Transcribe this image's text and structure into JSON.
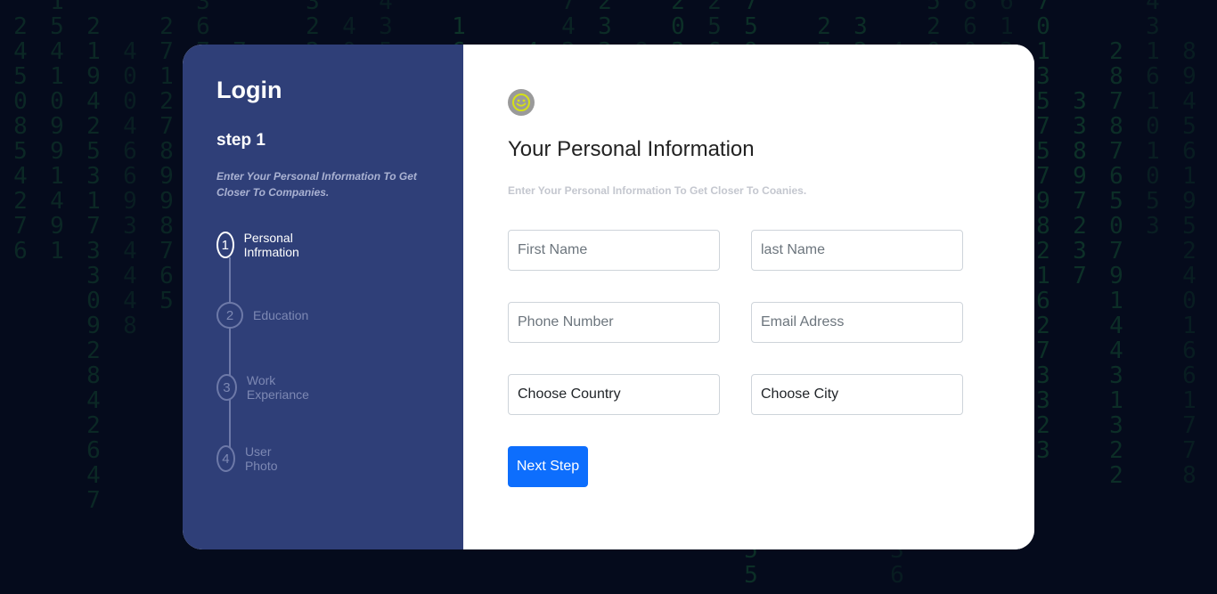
{
  "sidebar": {
    "title": "Login",
    "step": "step 1",
    "description": "Enter Your Personal Information To Get Closer To Companies.",
    "steps": [
      {
        "number": "1",
        "label": "Personal Infrmation",
        "active": true
      },
      {
        "number": "2",
        "label": "Education",
        "active": false
      },
      {
        "number": "3",
        "label": "Work Experiance",
        "active": false
      },
      {
        "number": "4",
        "label": "User Photo",
        "active": false
      }
    ]
  },
  "main": {
    "icon": "smiley-icon",
    "heading": "Your Personal Information",
    "subheading": "Enter Your Personal Information To Get Closer To Coanies.",
    "fields": {
      "first_name": {
        "placeholder": "First Name",
        "value": ""
      },
      "last_name": {
        "placeholder": "last Name",
        "value": ""
      },
      "phone": {
        "placeholder": "Phone Number",
        "value": ""
      },
      "email": {
        "placeholder": "Email Adress",
        "value": ""
      },
      "country": {
        "selected": "Choose Country"
      },
      "city": {
        "selected": "Choose City"
      }
    },
    "next_button": "Next Step"
  },
  "colors": {
    "background": "#050b1c",
    "sidebar": "#2f3f78",
    "accent": "#0d6efd",
    "smiley_face": "#9a9a9a",
    "smiley_features": "#d4e016"
  }
}
